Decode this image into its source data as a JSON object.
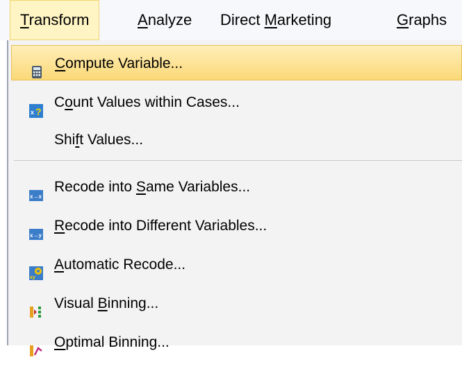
{
  "menubar": {
    "transform": {
      "pre": "",
      "u": "T",
      "post": "ransform"
    },
    "analyze": {
      "pre": "",
      "u": "A",
      "post": "nalyze"
    },
    "direct_marketing": {
      "pre": "Direct ",
      "u": "M",
      "post": "arketing"
    },
    "graphs": {
      "pre": "",
      "u": "G",
      "post": "raphs"
    }
  },
  "menu": {
    "compute_variable": {
      "pre": "",
      "u": "C",
      "post": "ompute Variable..."
    },
    "count_values": {
      "pre": "C",
      "u": "o",
      "post": "unt Values within Cases..."
    },
    "shift_values": {
      "pre": "Shi",
      "u": "f",
      "post": "t Values..."
    },
    "recode_same": {
      "pre": "Recode into ",
      "u": "S",
      "post": "ame Variables..."
    },
    "recode_different": {
      "pre": "",
      "u": "R",
      "post": "ecode into Different Variables..."
    },
    "automatic_recode": {
      "pre": "",
      "u": "A",
      "post": "utomatic Recode..."
    },
    "visual_binning": {
      "pre": "Visual ",
      "u": "B",
      "post": "inning..."
    },
    "optimal_binning": {
      "pre": "",
      "u": "O",
      "post": "ptimal Binning..."
    }
  },
  "icons": {
    "compute": "calculator-icon",
    "count": "count-values-icon",
    "recode_same": "recode-same-icon",
    "recode_different": "recode-different-icon",
    "automatic": "automatic-recode-icon",
    "visual_binning": "visual-binning-icon",
    "optimal_binning": "optimal-binning-icon"
  },
  "colors": {
    "highlight": "#fbd978",
    "menubar_active": "#fff5c4",
    "menu_bg": "#f3f3f4"
  }
}
